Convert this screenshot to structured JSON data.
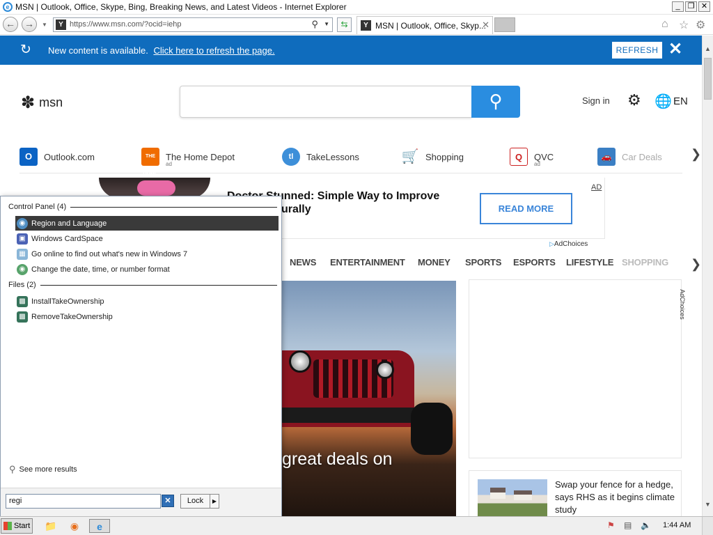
{
  "window": {
    "title": "MSN | Outlook, Office, Skype, Bing, Breaking News, and Latest Videos - Internet Explorer",
    "buttons": {
      "minimize": "_",
      "restore": "❐",
      "close": "✕"
    }
  },
  "navbar": {
    "url": "https://www.msn.com/?ocid=iehp",
    "tab_label": "MSN | Outlook, Office, Skyp...",
    "tab_close": "✕",
    "site_icon": "Y"
  },
  "page": {
    "banner": {
      "message": "New content is available.",
      "link": "Click here to refresh the page.",
      "button": "REFRESH",
      "close": "✕"
    },
    "logo": {
      "text": "msn"
    },
    "header": {
      "sign_in": "Sign in",
      "language": "EN"
    },
    "quicklinks": [
      {
        "name": "ql-outlook",
        "label": "Outlook.com",
        "icon": "O",
        "ad": ""
      },
      {
        "name": "ql-homedepot",
        "label": "The Home Depot",
        "icon": "THE HOME",
        "ad": "ad"
      },
      {
        "name": "ql-takelessons",
        "label": "TakeLessons",
        "icon": "tl",
        "ad": ""
      },
      {
        "name": "ql-shopping",
        "label": "Shopping",
        "icon": "🛒",
        "ad": ""
      },
      {
        "name": "ql-qvc",
        "label": "QVC",
        "icon": "Q",
        "ad": "ad"
      },
      {
        "name": "ql-cardeals",
        "label": "Car Deals",
        "icon": "🚗",
        "ad": ""
      }
    ],
    "ad": {
      "headline": "Doctor Stunned: Simple Way to Improve Vision Naturally",
      "label": "AD",
      "button": "READ MORE",
      "adchoices": "AdChoices"
    },
    "categories": [
      "NEWS",
      "ENTERTAINMENT",
      "MONEY",
      "SPORTS",
      "ESPORTS",
      "LIFESTYLE",
      "SHOPPING"
    ],
    "hero": {
      "headline": "great deals on"
    },
    "side_ad": {
      "adchoices": "AdChoices"
    },
    "news_card": {
      "text": "Swap your fence for a hedge, says RHS as it begins climate study"
    }
  },
  "start_menu": {
    "sections": [
      {
        "title": "Control Panel (4)",
        "items": [
          {
            "label": "Region and Language",
            "icon": "globe-icon",
            "selected": true
          },
          {
            "label": "Windows CardSpace",
            "icon": "cardspace-icon",
            "selected": false
          },
          {
            "label": "Go online to find out what's new in Windows 7",
            "icon": "windows-icon",
            "selected": false
          },
          {
            "label": "Change the date, time, or number format",
            "icon": "globe-icon",
            "selected": false
          }
        ]
      },
      {
        "title": "Files (2)",
        "items": [
          {
            "label": "InstallTakeOwnership",
            "icon": "registry-file-icon",
            "selected": false
          },
          {
            "label": "RemoveTakeOwnership",
            "icon": "registry-file-icon",
            "selected": false
          }
        ]
      }
    ],
    "see_more": "See more results",
    "search_value": "regi",
    "lock_label": "Lock"
  },
  "taskbar": {
    "start_label": "Start",
    "clock": "1:44 AM"
  },
  "colors": {
    "msn_blue": "#0f6cbd",
    "search_blue": "#2a8de0",
    "selected_item": "#3a3a3a"
  }
}
